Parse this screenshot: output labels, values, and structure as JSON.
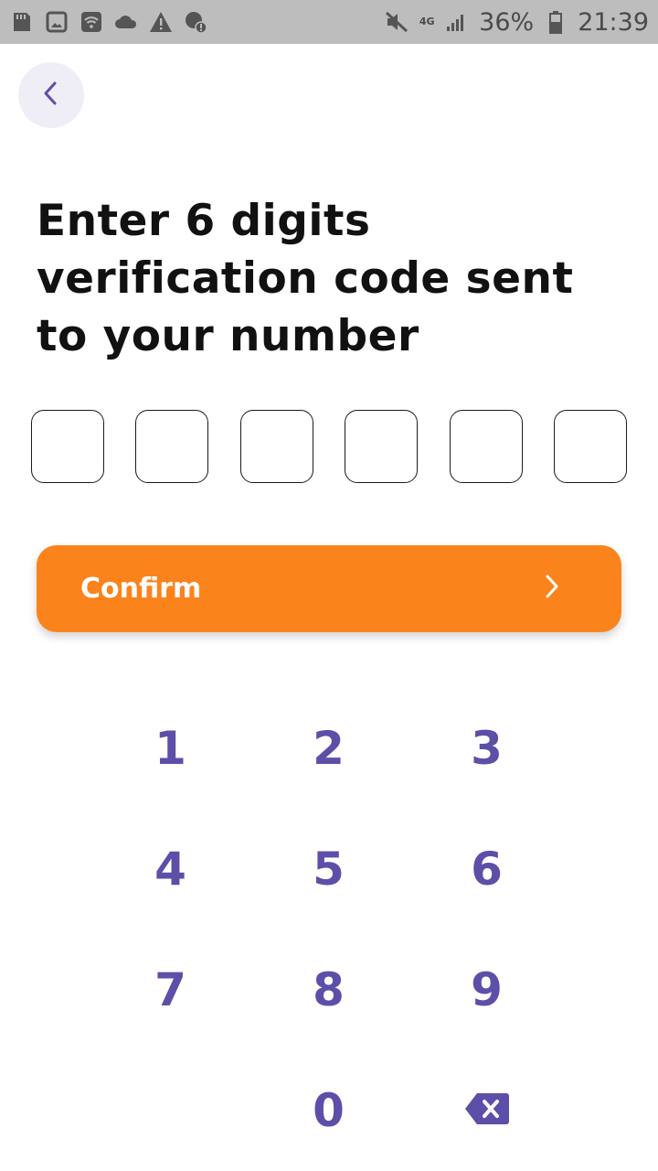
{
  "status_bar": {
    "left_icons": [
      "sd-card-icon",
      "image-icon",
      "wifi-icon",
      "cloud-icon",
      "warning-icon",
      "location-alert-icon"
    ],
    "mute_icon": "mute-icon",
    "network_type": "4G",
    "battery_percent": "36%",
    "time": "21:39"
  },
  "header": {
    "back_icon": "chevron-left-icon"
  },
  "main": {
    "title": "Enter 6 digits verification code sent to your number",
    "code_boxes": [
      "",
      "",
      "",
      "",
      "",
      ""
    ],
    "confirm_label": "Confirm"
  },
  "keypad": {
    "rows": [
      [
        "1",
        "2",
        "3"
      ],
      [
        "4",
        "5",
        "6"
      ],
      [
        "7",
        "8",
        "9"
      ],
      [
        "",
        "0",
        "backspace"
      ]
    ]
  },
  "colors": {
    "accent": "#fb831c",
    "keypad_text": "#5c4fa8",
    "back_button_bg": "#efeef7",
    "status_bar_bg": "#bdbdbd"
  }
}
